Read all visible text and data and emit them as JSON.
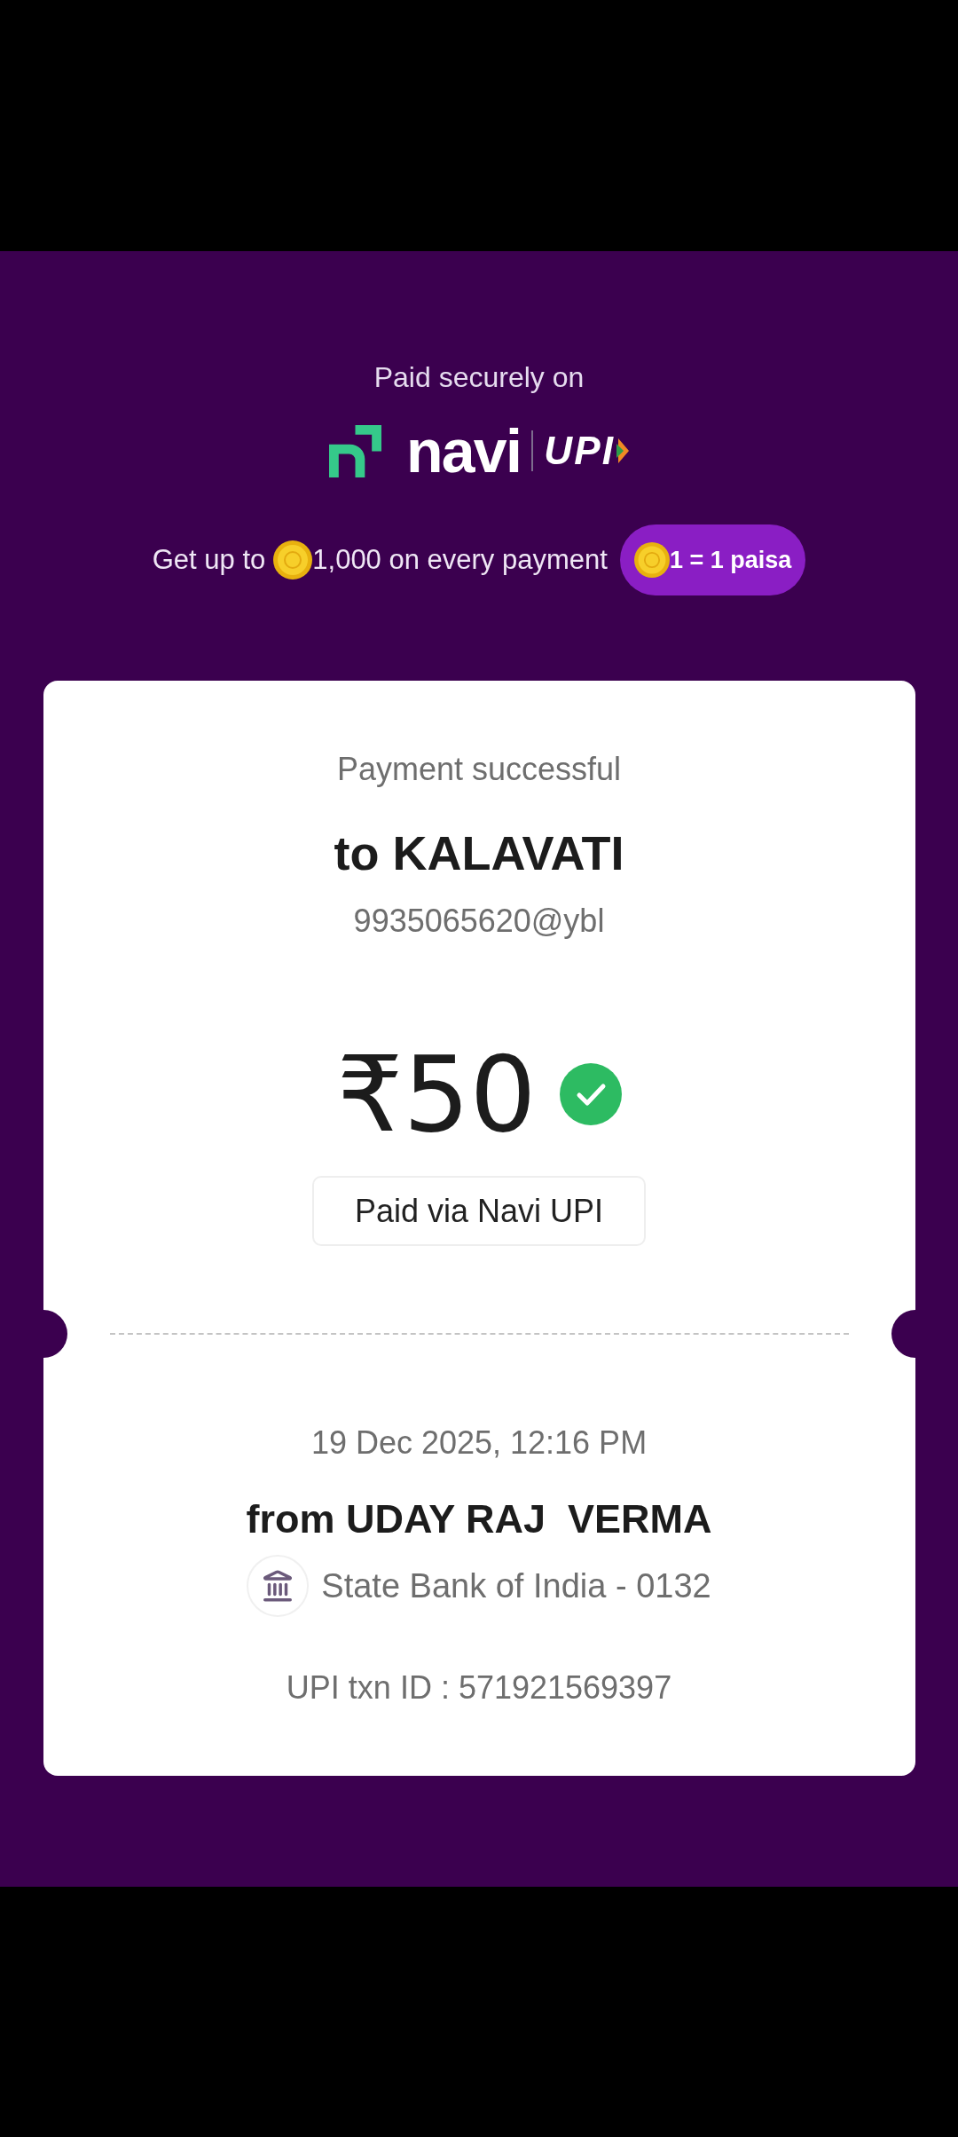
{
  "header": {
    "caption": "Paid securely on",
    "logo": {
      "wordmark": "navi",
      "partner": "UPI"
    }
  },
  "promo": {
    "text_before_coin": "Get up to",
    "text_after_coin": "1,000 on every payment",
    "badge": "1 = 1 paisa"
  },
  "receipt": {
    "status": "Payment successful",
    "payee": "to KALAVATI",
    "payee_vpa": "9935065620@ybl",
    "amount": "₹50",
    "method": "Paid via Navi UPI",
    "datetime": "19 Dec 2025, 12:16 PM",
    "payer": "from UDAY RAJ  VERMA",
    "bank": "State Bank of India - 0132",
    "txn_id": "UPI txn ID : 571921569397"
  }
}
